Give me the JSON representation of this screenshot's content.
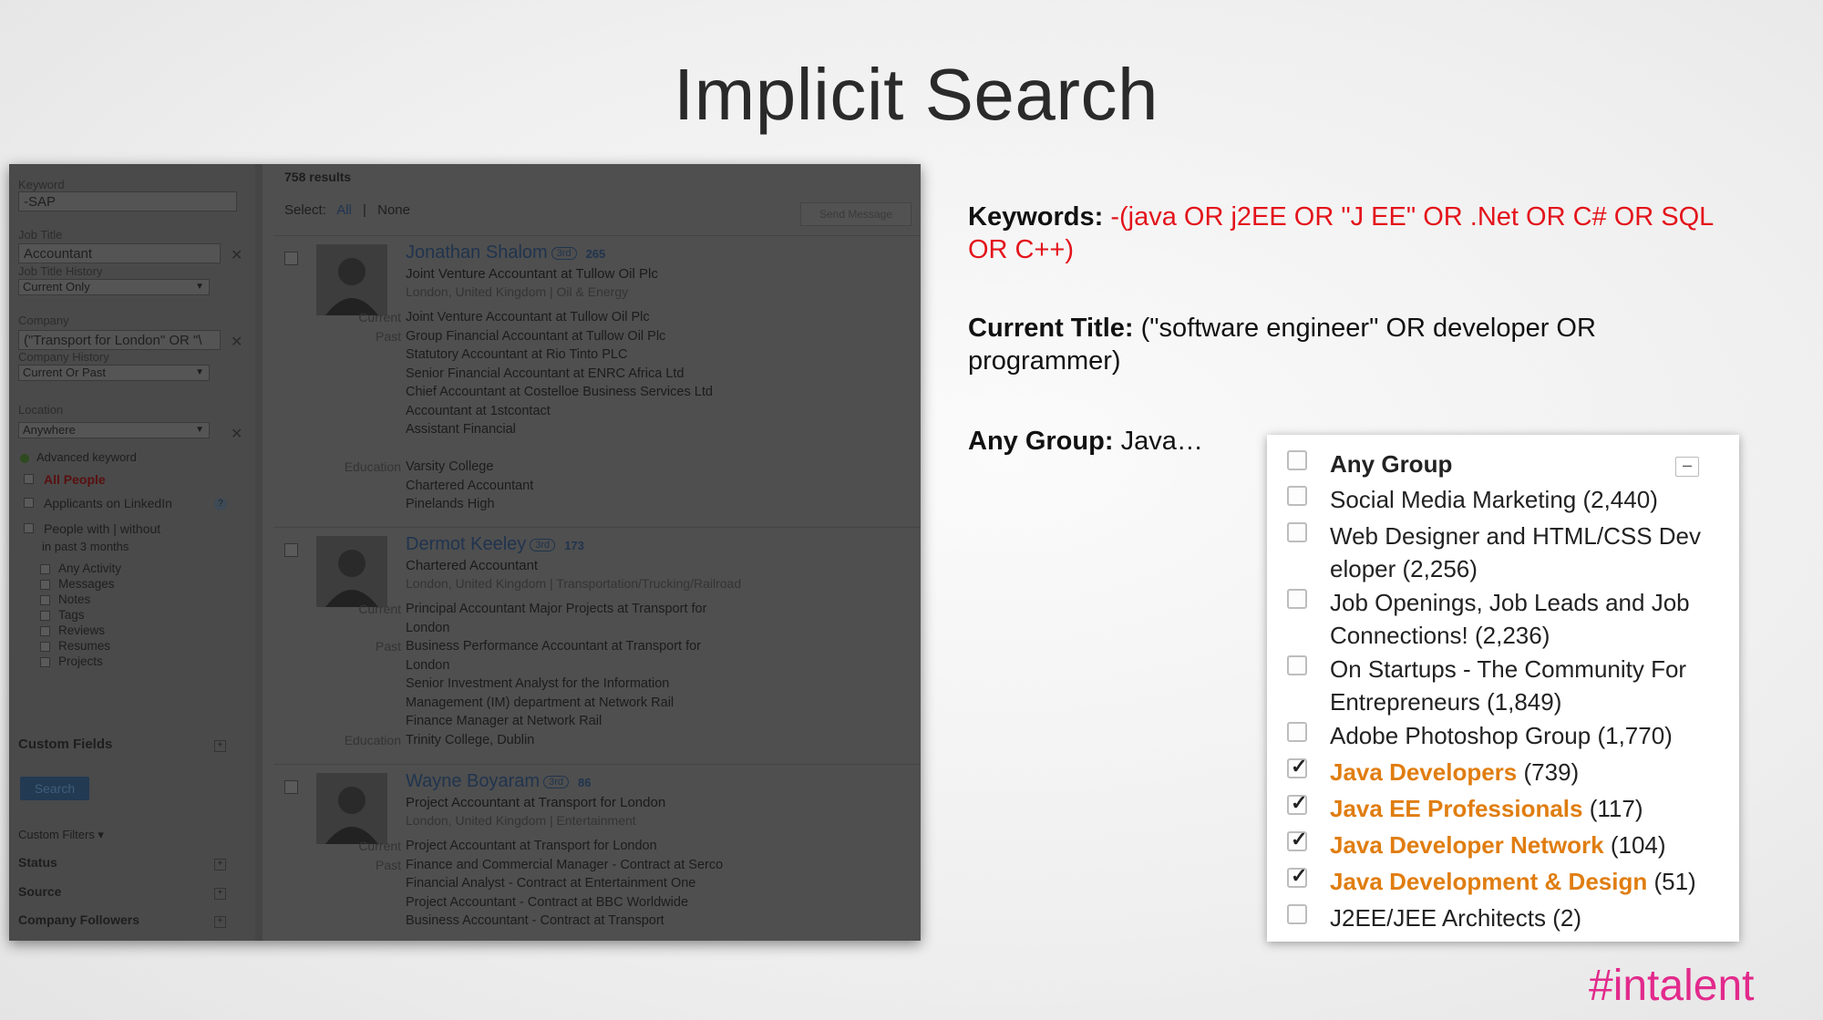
{
  "slide": {
    "title": "Implicit Search",
    "hashtag": "#intalent"
  },
  "sidebar": {
    "keyword_label": "Keyword",
    "keyword_value": "-SAP",
    "job_title_label": "Job Title",
    "job_title_value": "Accountant",
    "job_title_history_label": "Job Title History",
    "job_title_history_value": "Current Only",
    "company_label": "Company",
    "company_value": "(\"Transport for London\" OR \"\\",
    "company_history_label": "Company History",
    "company_history_value": "Current Or Past",
    "location_label": "Location",
    "location_value": "Anywhere",
    "advanced_keyword": "Advanced keyword",
    "all_people": "All People",
    "applicants": "Applicants on LinkedIn",
    "people_with": "People with | without",
    "in_past": "in past 3 months",
    "activity_items": [
      "Any Activity",
      "Messages",
      "Notes",
      "Tags",
      "Reviews",
      "Resumes",
      "Projects"
    ],
    "custom_fields": "Custom Fields",
    "search_button": "Search",
    "custom_filters": "Custom Filters ▾",
    "status": "Status",
    "source": "Source",
    "company_followers": "Company Followers"
  },
  "results": {
    "count": "758 results",
    "select_label": "Select:",
    "select_all": "All",
    "select_none": "None",
    "send_message": "Send Message",
    "people": [
      {
        "name": "Jonathan Shalom",
        "degree": "3rd",
        "connections": "265",
        "headline": "Joint Venture Accountant at Tullow Oil Plc",
        "location": "London, United Kingdom  |  Oil & Energy",
        "current_label": "Current",
        "current": [
          "Joint Venture Accountant at Tullow Oil Plc"
        ],
        "past_label": "Past",
        "past": [
          "Group Financial Accountant at Tullow Oil Plc",
          "Statutory Accountant at Rio Tinto PLC",
          "Senior Financial Accountant at ENRC Africa Ltd",
          "Chief Accountant at Costelloe Business Services Ltd",
          "Accountant at 1stcontact",
          "Assistant Financial"
        ],
        "education_label": "Education",
        "education": [
          "Varsity College",
          "Chartered Accountant",
          "Pinelands High"
        ]
      },
      {
        "name": "Dermot Keeley",
        "degree": "3rd",
        "connections": "173",
        "headline": "Chartered Accountant",
        "location": "London, United Kingdom  |  Transportation/Trucking/Railroad",
        "current_label": "Current",
        "current": [
          "Principal Accountant Major Projects at Transport for",
          "London"
        ],
        "past_label": "Past",
        "past": [
          "Business Performance Accountant at Transport for",
          "London",
          "Senior Investment Analyst for the Information",
          "Management (IM) department at Network Rail",
          "Finance Manager at Network Rail"
        ],
        "education_label": "Education",
        "education": [
          "Trinity College, Dublin"
        ]
      },
      {
        "name": "Wayne Boyaram",
        "degree": "3rd",
        "connections": "86",
        "headline": "Project Accountant at Transport for London",
        "location": "London, United Kingdom  |  Entertainment",
        "current_label": "Current",
        "current": [
          "Project Accountant at Transport for London"
        ],
        "past_label": "Past",
        "past": [
          "Finance and Commercial Manager - Contract at Serco",
          "Financial Analyst - Contract at Entertainment One",
          "Project Accountant - Contract at BBC Worldwide",
          "Business Accountant - Contract at Transport"
        ]
      }
    ]
  },
  "criteria": {
    "keywords_label": "Keywords:",
    "keywords_line1": "-(java OR j2EE OR \"J EE\" OR .Net OR C# OR SQL",
    "keywords_line2": "OR C++)",
    "title_label": "Current  Title:",
    "title_line1": "(\"software engineer\" OR developer OR",
    "title_line2": "programmer)",
    "group_label": "Any Group:",
    "group_value": "Java…"
  },
  "groups_panel": {
    "header": "Any Group",
    "collapse": "–",
    "items": [
      {
        "lines": [
          "Social Media Marketing"
        ],
        "count": "(2,440)",
        "checked": false
      },
      {
        "lines": [
          "Web Designer and HTML/CSS Dev",
          "eloper"
        ],
        "count": "(2,256)",
        "checked": false
      },
      {
        "lines": [
          "Job Openings, Job Leads and Job",
          "Connections!"
        ],
        "count": "(2,236)",
        "checked": false
      },
      {
        "lines": [
          "On Startups - The Community For",
          "Entrepreneurs"
        ],
        "count": "(1,849)",
        "checked": false
      },
      {
        "lines": [
          "Adobe Photoshop Group"
        ],
        "count": "(1,770)",
        "checked": false
      },
      {
        "lines": [
          "Java Developers"
        ],
        "count": "(739)",
        "checked": true
      },
      {
        "lines": [
          "Java EE Professionals"
        ],
        "count": "(117)",
        "checked": true
      },
      {
        "lines": [
          "Java Developer Network"
        ],
        "count": "(104)",
        "checked": true
      },
      {
        "lines": [
          "Java Development & Design"
        ],
        "count": "(51)",
        "checked": true
      },
      {
        "lines": [
          "J2EE/JEE Architects"
        ],
        "count": "(2)",
        "checked": false
      }
    ]
  },
  "colors": {
    "keyword_red": "#e3141b",
    "group_highlight": "#e07d10",
    "hashtag": "#e22a8c"
  }
}
